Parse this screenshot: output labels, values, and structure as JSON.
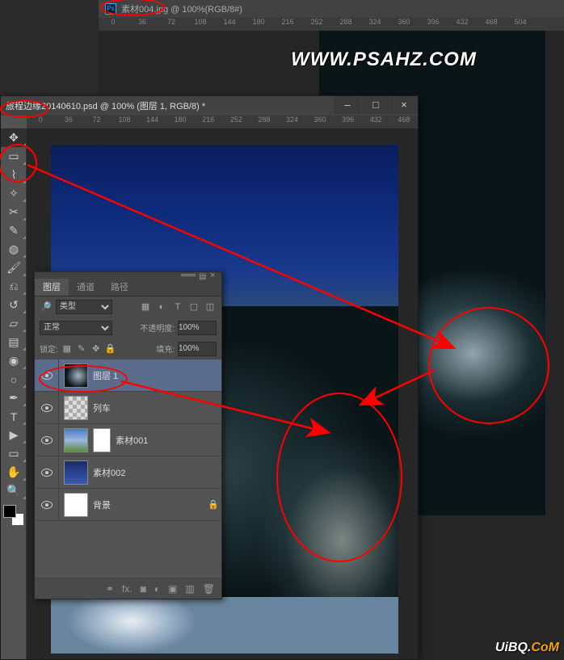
{
  "bg_tab": {
    "icon": "Ps",
    "title": "素材004.jpg @ 100%(RGB/8#)"
  },
  "bg_ruler": [
    "0",
    "36",
    "72",
    "108",
    "144",
    "180",
    "216",
    "252",
    "288",
    "324",
    "360",
    "396",
    "432",
    "468",
    "504"
  ],
  "watermark": "WWW.PSAHZ.COM",
  "fg_title": "旅程边缘20140610.psd @ 100% (图层 1, RGB/8) *",
  "window_buttons": {
    "min": "–",
    "max": "□",
    "close": "×"
  },
  "fg_ruler": [
    "0",
    "36",
    "72",
    "108",
    "144",
    "180",
    "216",
    "252",
    "288",
    "324",
    "360",
    "396",
    "432",
    "468"
  ],
  "tools": [
    {
      "n": "move-tool",
      "g": "✥",
      "sel": true
    },
    {
      "n": "marquee-tool",
      "g": "▭"
    },
    {
      "n": "lasso-tool",
      "g": "⌇"
    },
    {
      "n": "magic-wand-tool",
      "g": "✧"
    },
    {
      "n": "crop-tool",
      "g": "✂"
    },
    {
      "n": "eyedropper-tool",
      "g": "✎"
    },
    {
      "n": "healing-brush-tool",
      "g": "◍"
    },
    {
      "n": "brush-tool",
      "g": "🖌"
    },
    {
      "n": "clone-stamp-tool",
      "g": "⎌"
    },
    {
      "n": "history-brush-tool",
      "g": "↺"
    },
    {
      "n": "eraser-tool",
      "g": "▱"
    },
    {
      "n": "gradient-tool",
      "g": "▤"
    },
    {
      "n": "blur-tool",
      "g": "◉"
    },
    {
      "n": "dodge-tool",
      "g": "○"
    },
    {
      "n": "pen-tool",
      "g": "✒"
    },
    {
      "n": "type-tool",
      "g": "T"
    },
    {
      "n": "path-select-tool",
      "g": "▶"
    },
    {
      "n": "shape-tool",
      "g": "▭"
    },
    {
      "n": "hand-tool",
      "g": "✋"
    },
    {
      "n": "zoom-tool",
      "g": "🔍"
    }
  ],
  "layers_panel": {
    "tabs": [
      "图层",
      "通道",
      "路径"
    ],
    "filter_label": "类型",
    "filter_icons": [
      {
        "n": "filter-pixel-icon",
        "g": "▦"
      },
      {
        "n": "filter-adjust-icon",
        "g": "◐"
      },
      {
        "n": "filter-type-icon",
        "g": "T"
      },
      {
        "n": "filter-shape-icon",
        "g": "▢"
      },
      {
        "n": "filter-smart-icon",
        "g": "◫"
      }
    ],
    "blend_modes": [
      "正常"
    ],
    "blend_selected": "正常",
    "opacity_label": "不透明度:",
    "opacity_value": "100%",
    "lock_label": "锁定:",
    "lock_icons": [
      {
        "n": "lock-pixels-icon",
        "g": "▦"
      },
      {
        "n": "lock-brush-icon",
        "g": "✎"
      },
      {
        "n": "lock-position-icon",
        "g": "✥"
      },
      {
        "n": "lock-all-icon",
        "g": "🔒"
      }
    ],
    "fill_label": "填充:",
    "fill_value": "100%",
    "layers": [
      {
        "name": "图层 1",
        "thumb": "th-frac",
        "mask": false,
        "locked": false,
        "sel": true
      },
      {
        "name": "列车",
        "thumb": "th-train",
        "mask": false,
        "locked": false,
        "sel": false
      },
      {
        "name": "素材001",
        "thumb": "th-sky",
        "mask": true,
        "locked": false,
        "sel": false
      },
      {
        "name": "素材002",
        "thumb": "th-sky2",
        "mask": false,
        "locked": false,
        "sel": false
      },
      {
        "name": "背景",
        "thumb": "",
        "mask": false,
        "locked": true,
        "sel": false
      }
    ],
    "footer_icons": [
      {
        "n": "link-layers-icon",
        "g": "⚭"
      },
      {
        "n": "fx-icon",
        "g": "fx."
      },
      {
        "n": "mask-icon",
        "g": "◙"
      },
      {
        "n": "adjustment-icon",
        "g": "◐"
      },
      {
        "n": "group-icon",
        "g": "▣"
      },
      {
        "n": "new-layer-icon",
        "g": "▥"
      },
      {
        "n": "delete-layer-icon",
        "g": "🗑"
      }
    ]
  },
  "uibq": {
    "a": "UiBQ.",
    "b": "CoM"
  }
}
